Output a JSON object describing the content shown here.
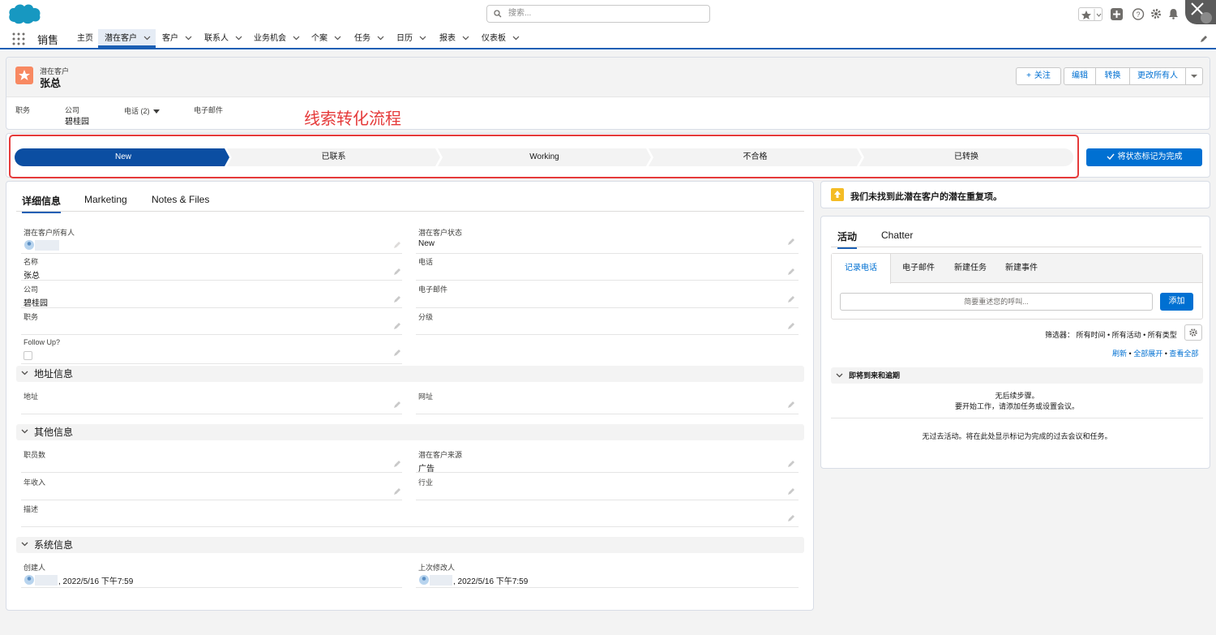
{
  "header": {
    "search_placeholder": "搜索...",
    "app_name": "销售",
    "nav_items": [
      {
        "label": "主页"
      },
      {
        "label": "潜在客户"
      },
      {
        "label": "客户"
      },
      {
        "label": "联系人"
      },
      {
        "label": "业务机会"
      },
      {
        "label": "个案"
      },
      {
        "label": "任务"
      },
      {
        "label": "日历"
      },
      {
        "label": "报表"
      },
      {
        "label": "仪表板"
      }
    ]
  },
  "record": {
    "object_label": "潜在客户",
    "name": "张总",
    "buttons": {
      "follow": "关注",
      "edit": "编辑",
      "convert": "转换",
      "change_owner": "更改所有人"
    },
    "highlights": {
      "title_label": "职务",
      "company_label": "公司",
      "company_value": "碧桂园",
      "phone_label": "电话 (2)",
      "email_label": "电子邮件"
    },
    "annotation": "线索转化流程"
  },
  "path": {
    "stages": [
      "New",
      "已联系",
      "Working",
      "不合格",
      "已转换"
    ],
    "mark_complete": "将状态标记为完成",
    "active_color": "#0b4ea2"
  },
  "details": {
    "tabs": [
      "详细信息",
      "Marketing",
      "Notes & Files"
    ],
    "fields": {
      "owner_label": "潜在客户所有人",
      "status_label": "潜在客户状态",
      "status_value": "New",
      "name_label": "名称",
      "name_value": "张总",
      "phone_label": "电话",
      "company_label": "公司",
      "company_value": "碧桂园",
      "email_label": "电子邮件",
      "title_label": "职务",
      "rating_label": "分级",
      "followup_label": "Follow Up?"
    },
    "address_section": "地址信息",
    "address_label": "地址",
    "website_label": "网址",
    "other_section": "其他信息",
    "employees_label": "职员数",
    "source_label": "潜在客户来源",
    "source_value": "广告",
    "revenue_label": "年收入",
    "industry_label": "行业",
    "description_label": "描述",
    "system_section": "系统信息",
    "created_label": "创建人",
    "created_value": ", 2022/5/16 下午7:59",
    "modified_label": "上次修改人",
    "modified_value": ", 2022/5/16 下午7:59"
  },
  "duplicates": {
    "message": "我们未找到此潜在客户的潜在重复项。"
  },
  "activity": {
    "tabs": [
      "活动",
      "Chatter"
    ],
    "subtabs": [
      "记录电话",
      "电子邮件",
      "新建任务",
      "新建事件"
    ],
    "call_placeholder": "简要重述您的呼叫...",
    "add_button": "添加",
    "filter_text": "筛选器： 所有时间 • 所有活动 • 所有类型",
    "refresh": "刷新",
    "expand_all": "全部展开",
    "view_all": "查看全部",
    "upcoming_section": "即将到来和逾期",
    "no_steps_1": "无后续步骤。",
    "no_steps_2": "要开始工作，请添加任务或设置会议。",
    "no_past": "无过去活动。将在此处显示标记为完成的过去会议和任务。"
  }
}
